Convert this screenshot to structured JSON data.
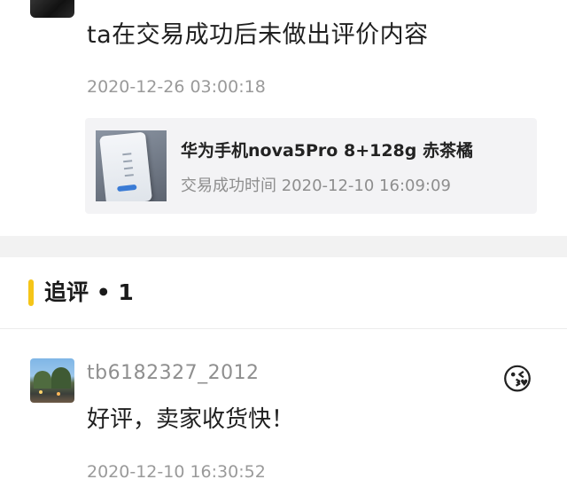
{
  "review": {
    "text": "ta在交易成功后未做出评价内容",
    "date": "2020-12-26 03:00:18"
  },
  "order": {
    "product_title": "华为手机nova5Pro  8+128g  赤茶橘",
    "trade_time": "交易成功时间 2020-12-10 16:09:09",
    "thumbnail_icon": "phone-product-image"
  },
  "followup": {
    "title": "追评 • 1",
    "accent_color": "#f5c518",
    "user": {
      "name": "tb6182327_2012",
      "avatar_icon": "landscape-avatar"
    },
    "emoji": "😘",
    "text": "好评，卖家收货快！",
    "date": "2020-12-10 16:30:52"
  }
}
